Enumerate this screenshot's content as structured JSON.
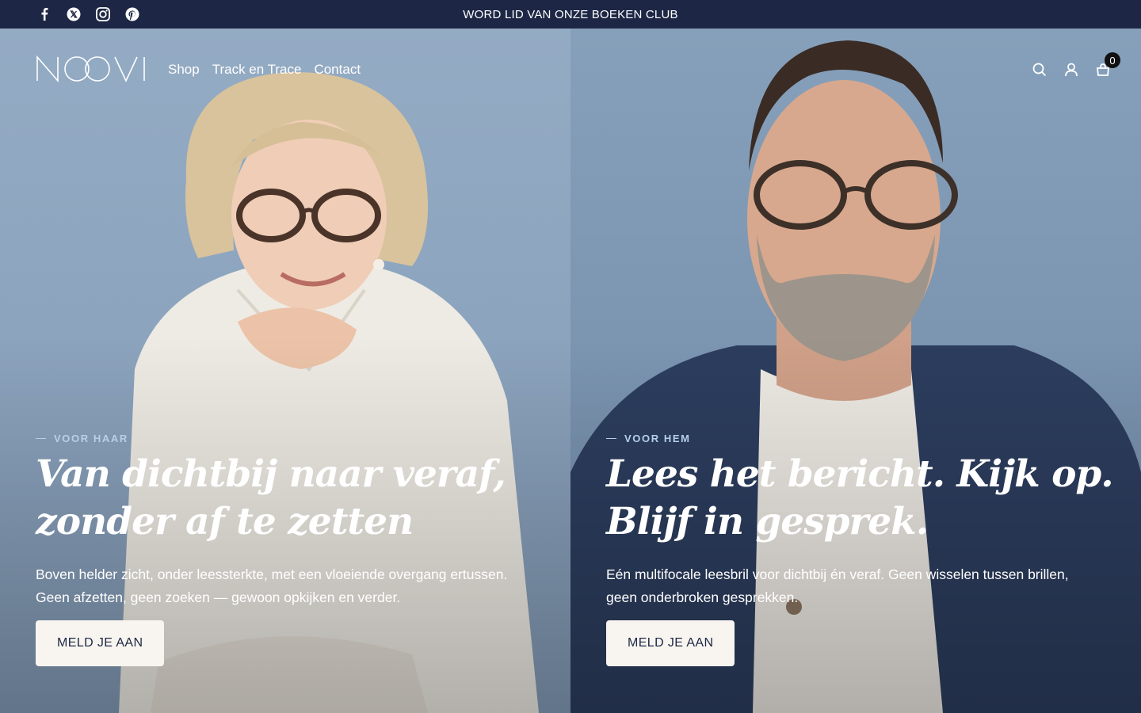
{
  "topbar": {
    "announcement": "WORD LID VAN ONZE BOEKEN CLUB",
    "social": [
      "facebook-icon",
      "x-icon",
      "instagram-icon",
      "pinterest-icon"
    ]
  },
  "header": {
    "logo": "NOOVI",
    "nav": [
      "Shop",
      "Track en Trace",
      "Contact"
    ],
    "cart_count": "0",
    "icons": [
      "search-icon",
      "account-icon",
      "cart-icon"
    ]
  },
  "hero": {
    "left": {
      "eyebrow": "VOOR HAAR",
      "headline_line1": "Van dichtbij naar veraf,",
      "headline_line2": "zonder af te zetten",
      "desc_line1": "Boven helder zicht, onder leessterkte, met een vloeiende overgang ertussen.",
      "desc_line2": "Geen afzetten, geen zoeken — gewoon opkijken en verder.",
      "cta": "MELD JE AAN"
    },
    "right": {
      "eyebrow": "VOOR HEM",
      "headline_line1": "Lees het bericht. Kijk op.",
      "headline_line2": "Blijf in gesprek.",
      "desc_line1": "Eén multifocale leesbril voor dichtbij én veraf. Geen wisselen tussen brillen,",
      "desc_line2": "geen onderbroken gesprekken.",
      "cta": "MELD JE AAN"
    }
  },
  "colors": {
    "topbar_bg": "#1d2745",
    "eyebrow": "#b6d0e8",
    "button_bg": "#f8f5f0",
    "button_text": "#1d2745"
  }
}
